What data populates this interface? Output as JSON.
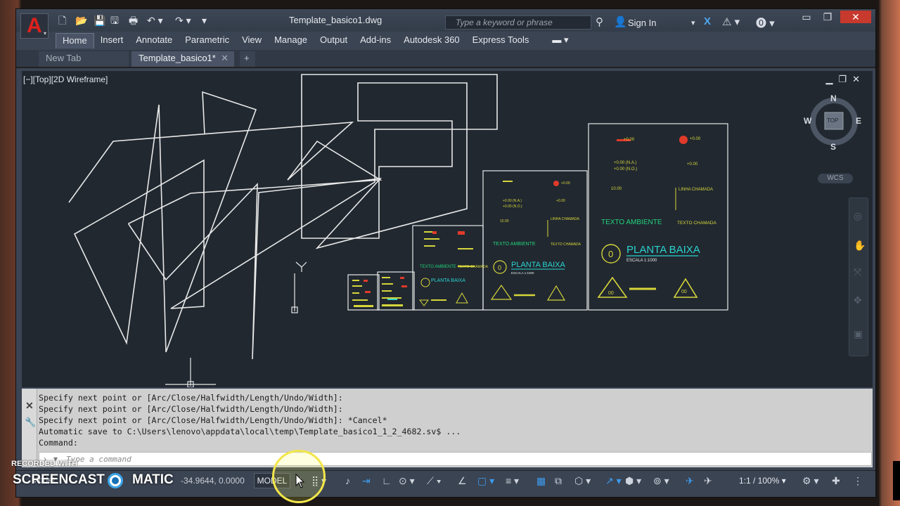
{
  "window": {
    "doc_title": "Template_basico1.dwg",
    "search_placeholder": "Type a keyword or phrase",
    "sign_in": "Sign In",
    "minimize": "▭",
    "restore": "❐",
    "close": "✕"
  },
  "ribbon": {
    "tabs": [
      "Home",
      "Insert",
      "Annotate",
      "Parametric",
      "View",
      "Manage",
      "Output",
      "Add-ins",
      "Autodesk 360",
      "Express Tools"
    ]
  },
  "doc_tabs": {
    "new_tab": "New Tab",
    "current": "Template_basico1*",
    "close": "✕",
    "add": "+"
  },
  "viewport": {
    "label": "[−][Top][2D Wireframe]",
    "controls": "▁❐✕",
    "viewcube": {
      "n": "N",
      "s": "S",
      "e": "E",
      "w": "W",
      "top": "TOP"
    },
    "wcs": "WCS",
    "ucs_y": "Y"
  },
  "drawing": {
    "texto_ambiente": "TEXTO AMBIENTE",
    "texto_chamada": "TEXTO CHAMADA",
    "planta_baixa": "PLANTA BAIXA",
    "escala": "ESCALA 1:1000",
    "linha_chamada": "LINHA CHAMADA",
    "elev1": "+0.00",
    "elev2": "+0.00 (N.A.)",
    "elev3": "+0.00 (N.O.)",
    "elev4": "10.00",
    "num": "0",
    "sub": "00"
  },
  "command": {
    "lines": [
      "Specify next point or [Arc/Close/Halfwidth/Length/Undo/Width]:",
      "Specify next point or [Arc/Close/Halfwidth/Length/Undo/Width]:",
      "Specify next point or [Arc/Close/Halfwidth/Length/Undo/Width]: *Cancel*",
      "Automatic save to C:\\Users\\lenovo\\appdata\\local\\temp\\Template_basico1_1_2_4682.sv$ ...",
      "Command:"
    ],
    "placeholder": "Type a command"
  },
  "status": {
    "model_tab": "Model",
    "coords": "-34.9644, 0.0000",
    "model_button": "MODEL",
    "scale": "1:1 / 100% ▾"
  },
  "watermark": {
    "recorded": "RECORDED WITH",
    "screencast": "SCREENCAST",
    "matic": "MATIC"
  },
  "colors": {
    "accent_blue": "#3d9cf0",
    "acad_red": "#e0201c",
    "cursor_halo": "#f2e649"
  }
}
